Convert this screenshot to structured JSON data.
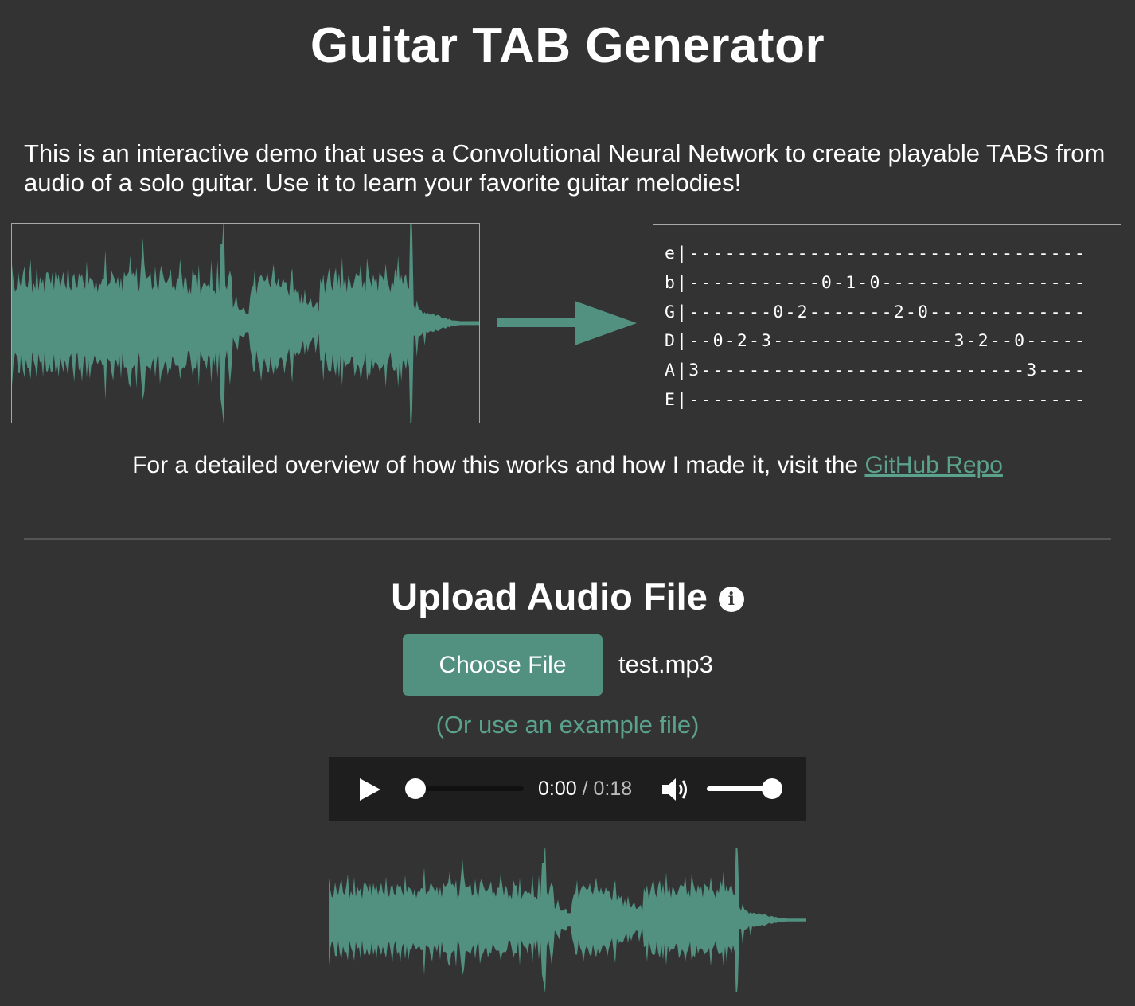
{
  "page": {
    "title": "Guitar TAB Generator",
    "intro": "This is an interactive demo that uses a Convolutional Neural Network to create playable TABS from audio of a solo guitar. Use it to learn your favorite guitar melodies!",
    "overview_text": "For a detailed overview of how this works and how I made it, visit the ",
    "overview_link": "GitHub Repo"
  },
  "tab": {
    "lines": [
      "e|---------------------------------",
      "b|-----------0-1-0-----------------",
      "G|-------0-2-------2-0-------------",
      "D|--0-2-3---------------3-2--0-----",
      "A|3---------------------------3----",
      "E|---------------------------------"
    ]
  },
  "upload": {
    "heading": "Upload Audio File",
    "info_icon": "i",
    "choose_label": "Choose File",
    "file_name": "test.mp3",
    "example_link": "(Or use an example file)"
  },
  "player": {
    "current_time": "0:00",
    "separator": " / ",
    "duration": "0:18",
    "progress": 0,
    "volume": 1
  },
  "colors": {
    "accent": "#529080",
    "waveform": "#529080",
    "background": "#333333",
    "player_bg": "#1e1e1e"
  }
}
